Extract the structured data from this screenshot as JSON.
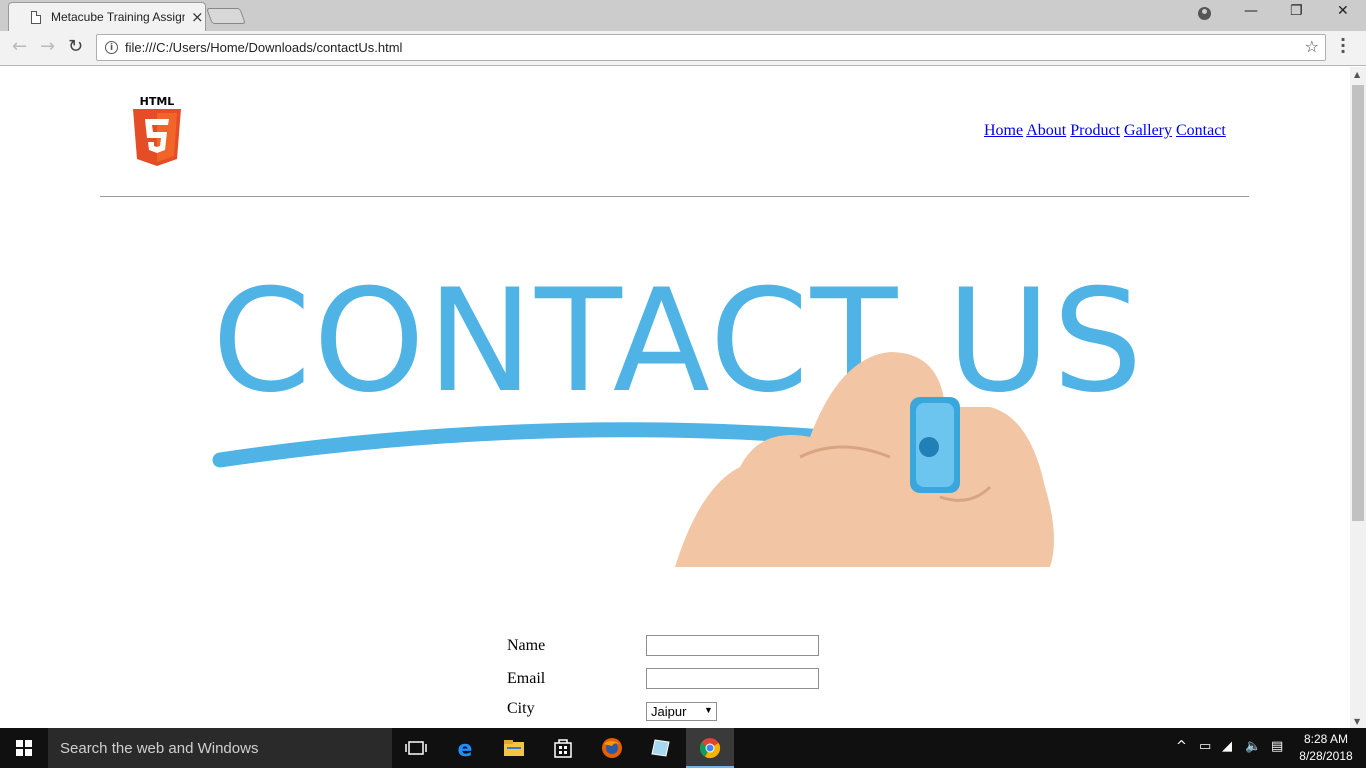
{
  "browser": {
    "tab_title": "Metacube Training Assignment",
    "tab_close": "×",
    "url": "file:///C:/Users/Home/Downloads/contactUs.html",
    "back": "←",
    "forward": "→",
    "reload": "↻",
    "bookmark_star": "☆",
    "minimize": "—",
    "restore": "❐",
    "close": "✕"
  },
  "page": {
    "logo_label": "HTML",
    "logo_number": "5",
    "nav": [
      "Home",
      "About",
      "Product",
      "Gallery",
      "Contact"
    ],
    "hero_text": "CONTACT US",
    "form": {
      "name_label": "Name",
      "email_label": "Email",
      "city_label": "City",
      "name_value": "",
      "email_value": "",
      "city_selected": "Jaipur"
    }
  },
  "taskbar": {
    "search_placeholder": "Search the web and Windows",
    "time": "8:28 AM",
    "date": "8/28/2018",
    "icons": [
      "task-view",
      "edge",
      "file-explorer",
      "store",
      "firefox",
      "notepad",
      "chrome"
    ]
  },
  "colors": {
    "chrome_titlebar": "#cccccc",
    "hero_blue": "#4fb3e6",
    "link": "#0000ee",
    "taskbar": "#101010"
  }
}
